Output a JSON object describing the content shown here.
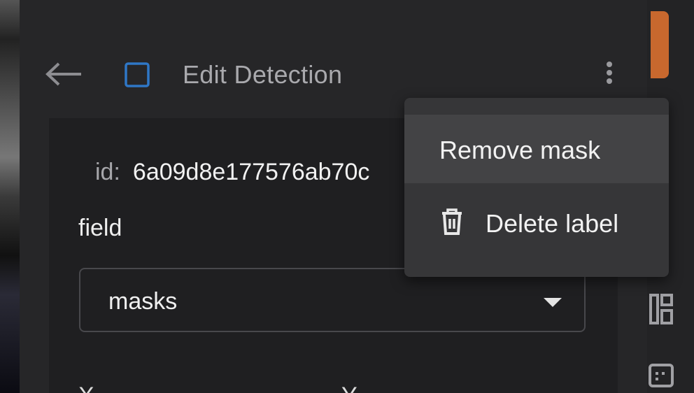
{
  "header": {
    "title": "Edit Detection"
  },
  "detail": {
    "id_label": "id:",
    "id_value": "6a09d8e177576ab70c",
    "field_label": "field",
    "field_value": "masks",
    "x_label": "X",
    "y_label": "Y"
  },
  "menu": {
    "items": [
      {
        "label": "Remove mask",
        "icon": "none"
      },
      {
        "label": "Delete label",
        "icon": "trash-icon"
      }
    ]
  },
  "colors": {
    "panel_bg": "#262628",
    "card_bg": "#1f1f21",
    "menu_bg": "#363638",
    "menu_highlight": "#434345",
    "accent_blue": "#2f77c6",
    "accent_orange": "#c8682e"
  }
}
